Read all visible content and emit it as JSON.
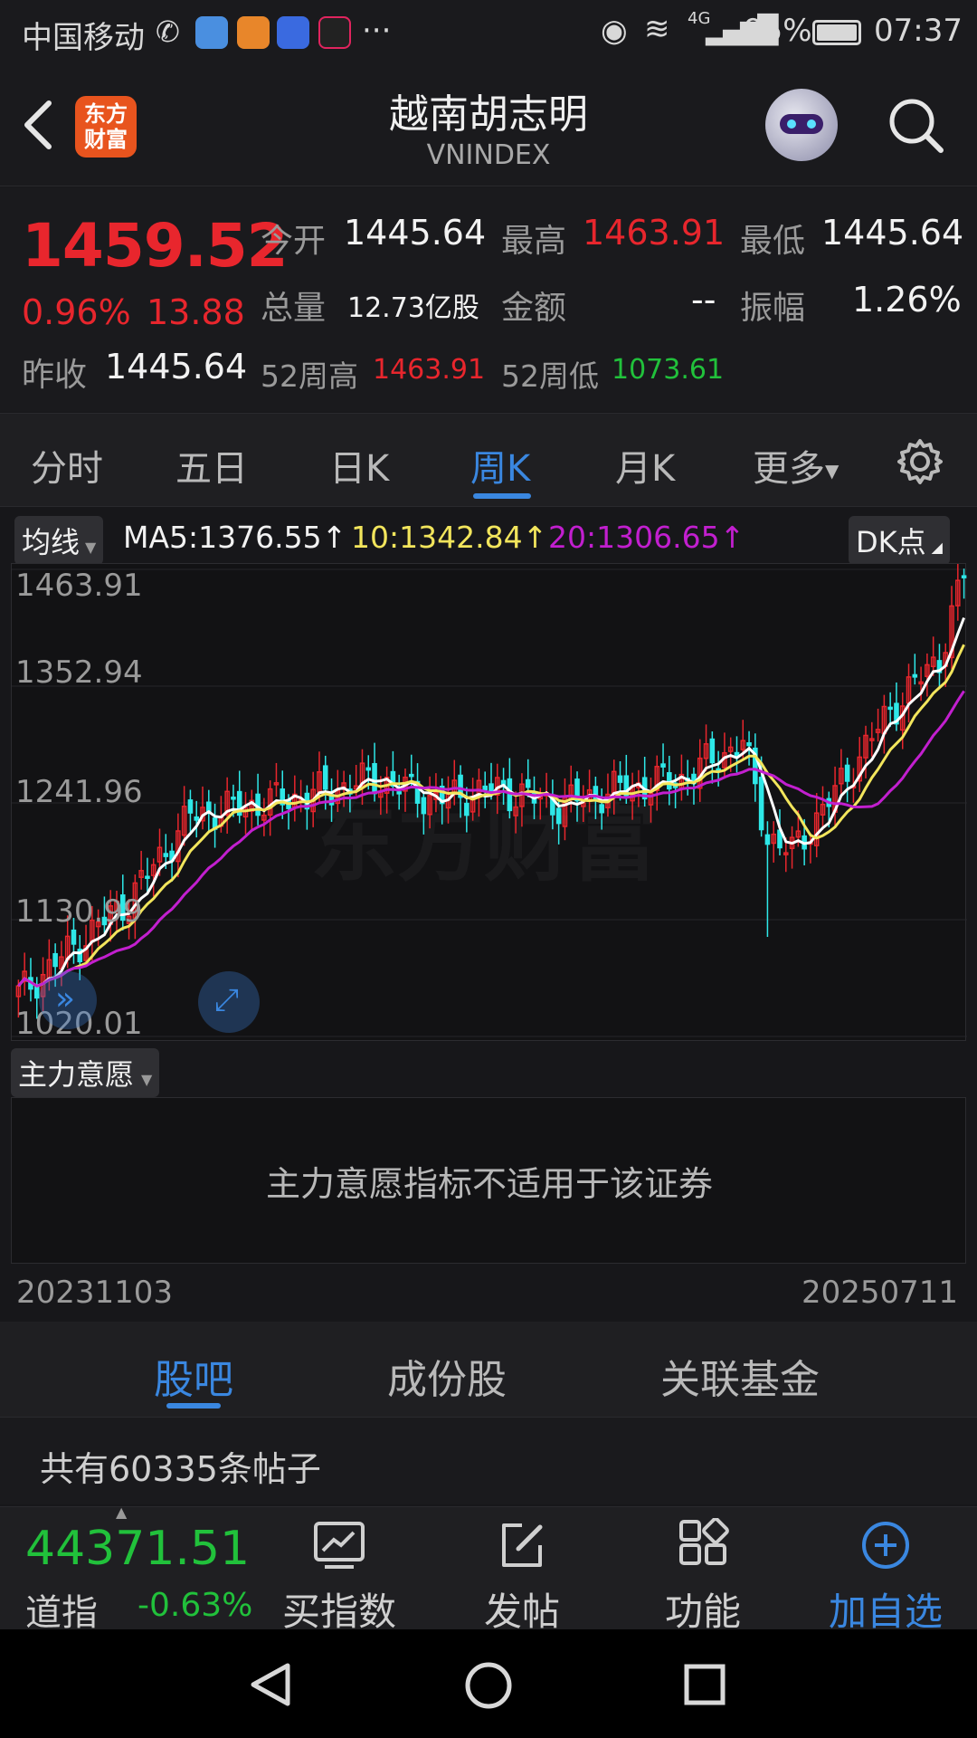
{
  "status_bar": {
    "carrier": "中国移动",
    "battery": "95%",
    "time": "07:37",
    "network": "4G",
    "more": "···"
  },
  "header": {
    "title": "越南胡志明",
    "code": "VNINDEX",
    "logo_text": "东方财富"
  },
  "quote": {
    "price": "1459.52",
    "change_pct": "0.96%",
    "change": "13.88",
    "prev_close_label": "昨收",
    "prev_close": "1445.64",
    "open_label": "今开",
    "open": "1445.64",
    "high_label": "最高",
    "high": "1463.91",
    "low_label": "最低",
    "low": "1445.64",
    "volume_label": "总量",
    "volume": "12.73亿股",
    "amount_label": "金额",
    "amount": "--",
    "amplitude_label": "振幅",
    "amplitude": "1.26%",
    "wk52_high_label": "52周高",
    "wk52_high": "1463.91",
    "wk52_low_label": "52周低",
    "wk52_low": "1073.61"
  },
  "period_tabs": [
    "分时",
    "五日",
    "日K",
    "周K",
    "月K",
    "更多"
  ],
  "active_tab": "周K",
  "ma_row": {
    "selector": "均线",
    "ma5": "MA5:1376.55↑",
    "ma10": "10:1342.84↑",
    "ma20": "20:1306.65↑",
    "dk_button": "DK点"
  },
  "chart_data": {
    "type": "candlestick",
    "y_ticks": [
      "1463.91",
      "1352.94",
      "1241.96",
      "1130.99",
      "1020.01"
    ],
    "ylim": [
      1020.01,
      1463.91
    ],
    "start_date": "20231103",
    "end_date": "20250711",
    "watermark": "东方财富",
    "ma_colors": {
      "ma5": "#ffffff",
      "ma10": "#f2e55c",
      "ma20": "#c21fcf"
    },
    "up_color": "#e8262d",
    "down_color": "#2ee8e8"
  },
  "indicator": {
    "selector": "主力意愿",
    "message": "主力意愿指标不适用于该证券"
  },
  "bottom_tabs": [
    "股吧",
    "成份股",
    "关联基金"
  ],
  "active_bottom_tab": "股吧",
  "posts_count_text": "共有60335条帖子",
  "ticker": {
    "value": "44371.51",
    "name": "道指",
    "change": "-0.63%"
  },
  "actions": [
    {
      "label": "买指数",
      "icon": "chart-icon"
    },
    {
      "label": "发帖",
      "icon": "edit-icon"
    },
    {
      "label": "功能",
      "icon": "grid-icon"
    },
    {
      "label": "加自选",
      "icon": "add-circle-icon"
    }
  ]
}
